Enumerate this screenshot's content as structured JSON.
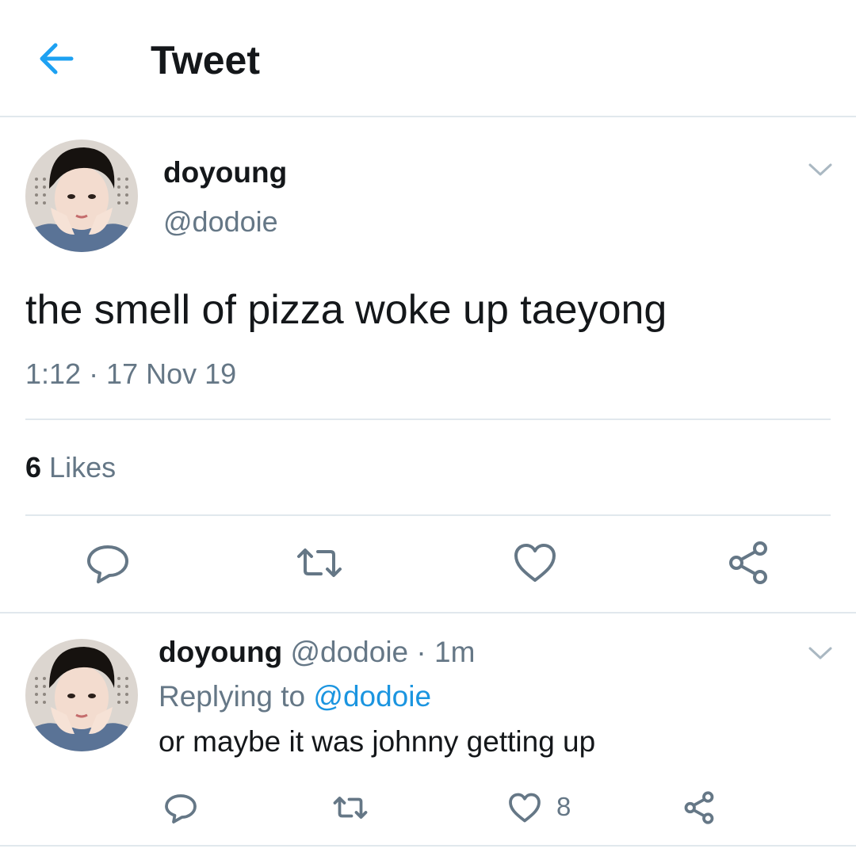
{
  "header": {
    "title": "Tweet",
    "back_icon": "arrow-left-icon",
    "accent_color": "#1da1f2"
  },
  "tweet": {
    "author_name": "doyoung",
    "author_handle": "@dodoie",
    "text": "the smell of pizza woke up taeyong",
    "timestamp": "1:12 · 17 Nov 19",
    "likes_count": "6",
    "likes_label": "Likes",
    "menu_icon": "chevron-down-icon",
    "actions": [
      "reply-icon",
      "retweet-icon",
      "like-icon",
      "share-icon"
    ]
  },
  "reply": {
    "author_name": "doyoung",
    "author_handle": "@dodoie",
    "time_ago": "· 1m",
    "replying_prefix": "Replying to",
    "replying_to": "@dodoie",
    "text": "or maybe it was johnny getting up",
    "like_count": "8",
    "menu_icon": "chevron-down-icon",
    "actions": [
      "reply-icon",
      "retweet-icon",
      "like-icon",
      "share-icon"
    ]
  },
  "colors": {
    "text_primary": "#14171a",
    "text_secondary": "#657786",
    "link": "#1b95e0",
    "divider": "#e1e8ed"
  }
}
